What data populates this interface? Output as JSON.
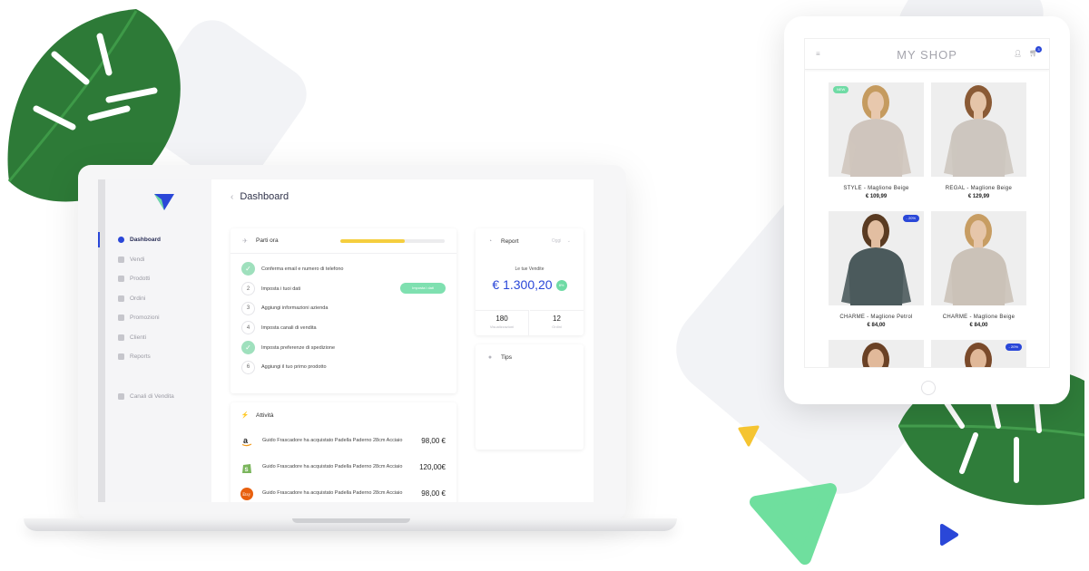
{
  "colors": {
    "accent": "#2a47d8",
    "green": "#6fdba5",
    "yellow": "#f5ce3e",
    "leaf": "#2f7d3a"
  },
  "dashboard": {
    "title": "Dashboard",
    "sidebar": {
      "items": [
        {
          "label": "Dashboard",
          "icon": "dashboard-icon",
          "active": true
        },
        {
          "label": "Vendi",
          "icon": "sell-icon"
        },
        {
          "label": "Prodotti",
          "icon": "products-icon"
        },
        {
          "label": "Ordini",
          "icon": "orders-icon"
        },
        {
          "label": "Promozioni",
          "icon": "tag-icon"
        },
        {
          "label": "Clienti",
          "icon": "user-icon"
        },
        {
          "label": "Reports",
          "icon": "chart-icon"
        }
      ],
      "bottom_item": {
        "label": "Canali di Vendita",
        "icon": "send-icon"
      }
    },
    "start": {
      "title": "Parti ora",
      "progress": 0.62,
      "steps": [
        {
          "marker": "✓",
          "text": "Conferma email e numero di telefono",
          "done": true
        },
        {
          "marker": "2",
          "text": "Imposta i tuoi dati",
          "done": false,
          "button": "Imposta i dati"
        },
        {
          "marker": "3",
          "text": "Aggiungi informazioni azienda",
          "done": false
        },
        {
          "marker": "4",
          "text": "Imposta canali di vendita",
          "done": false
        },
        {
          "marker": "✓",
          "text": "Imposta preferenze di spedizione",
          "done": true
        },
        {
          "marker": "6",
          "text": "Aggiungi il tuo primo prodotto",
          "done": false
        }
      ]
    },
    "activity": {
      "title": "Attività",
      "rows": [
        {
          "brand": "amazon-logo-icon",
          "text": "Guido Frascadore ha acquistato Padella Paderno 28cm Acciaio",
          "amount": "98,00 €"
        },
        {
          "brand": "shopify-logo-icon",
          "text": "Guido Frascadore ha acquistato Padella Paderno 28cm Acciaio",
          "amount": "120,00€"
        },
        {
          "brand": "etsy-logo-icon",
          "text": "Guido Frascadore ha acquistato Padella Paderno 28cm Acciaio",
          "amount": "98,00 €"
        }
      ]
    },
    "report": {
      "title": "Report",
      "period": "Oggi",
      "sales_label": "Le tue Vendite",
      "sales_value": "€ 1.300,20",
      "sales_badge": "8%",
      "stats": [
        {
          "value": "180",
          "label": "Visualizzazioni"
        },
        {
          "value": "12",
          "label": "Ordini"
        }
      ]
    },
    "tips": {
      "title": "Tips"
    }
  },
  "shop": {
    "title": "MY SHOP",
    "cart_count": "3",
    "products": [
      {
        "name": "STYLE - Maglione Beige",
        "price": "€ 109,99",
        "tag": "NEW",
        "sweater": "#cfc5bd",
        "skin": "#e8c8ad",
        "hair": "#c59b5f"
      },
      {
        "name": "REGAL - Maglione Beige",
        "price": "€ 129,99",
        "tag": "",
        "sweater": "#cdc6bf",
        "skin": "#e5c4a8",
        "hair": "#8a5a35"
      },
      {
        "name": "CHARME - Maglione Petrol",
        "price": "€ 84,00",
        "tag": "- 20%",
        "sweater": "#4b5a5c",
        "skin": "#e2bea1",
        "hair": "#5a3b22"
      },
      {
        "name": "CHARME - Maglione Beige",
        "price": "€ 84,00",
        "tag": "",
        "sweater": "#cbc2b8",
        "skin": "#e6c6aa",
        "hair": "#c79d63"
      },
      {
        "name": "",
        "price": "",
        "tag": "",
        "sweater": "#d9d9d9",
        "skin": "#e1b99a",
        "hair": "#6a4125"
      },
      {
        "name": "",
        "price": "",
        "tag": "- 20%",
        "sweater": "#7a3c48",
        "skin": "#e0b898",
        "hair": "#7a4a2a"
      }
    ]
  }
}
